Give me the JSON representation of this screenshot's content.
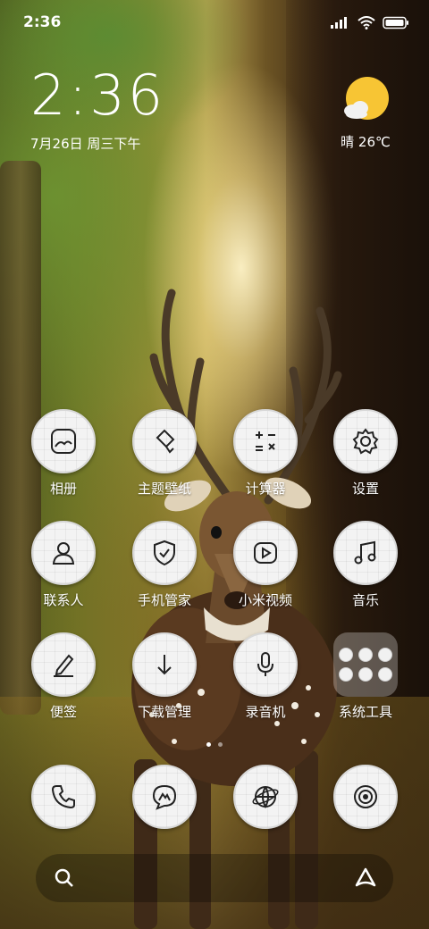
{
  "status_bar": {
    "time": "2:36",
    "icons": [
      "signal-icon",
      "wifi-icon",
      "battery-icon"
    ]
  },
  "clock": {
    "time": "2:36",
    "date": "7月26日 周三下午"
  },
  "weather": {
    "icon": "sunny-cloud-icon",
    "text": "晴 26℃"
  },
  "apps": [
    {
      "label": "相册",
      "icon": "gallery-icon"
    },
    {
      "label": "主题壁纸",
      "icon": "theme-brush-icon"
    },
    {
      "label": "计算器",
      "icon": "calculator-icon"
    },
    {
      "label": "设置",
      "icon": "gear-icon"
    },
    {
      "label": "联系人",
      "icon": "contact-icon"
    },
    {
      "label": "手机管家",
      "icon": "security-shield-icon"
    },
    {
      "label": "小米视频",
      "icon": "video-play-icon"
    },
    {
      "label": "音乐",
      "icon": "music-note-icon"
    },
    {
      "label": "便签",
      "icon": "notes-pen-icon"
    },
    {
      "label": "下载管理",
      "icon": "download-arrow-icon"
    },
    {
      "label": "录音机",
      "icon": "microphone-icon"
    },
    {
      "label": "系统工具",
      "icon": "folder-icon"
    }
  ],
  "dock": [
    {
      "name": "phone",
      "icon": "phone-icon"
    },
    {
      "name": "messages",
      "icon": "message-icon"
    },
    {
      "name": "browser",
      "icon": "globe-icon"
    },
    {
      "name": "camera",
      "icon": "camera-icon"
    }
  ],
  "page_indicator": {
    "pages": 2,
    "current": 1
  },
  "search_bar": {
    "left_icon": "search-icon",
    "right_icon": "assistant-icon"
  }
}
